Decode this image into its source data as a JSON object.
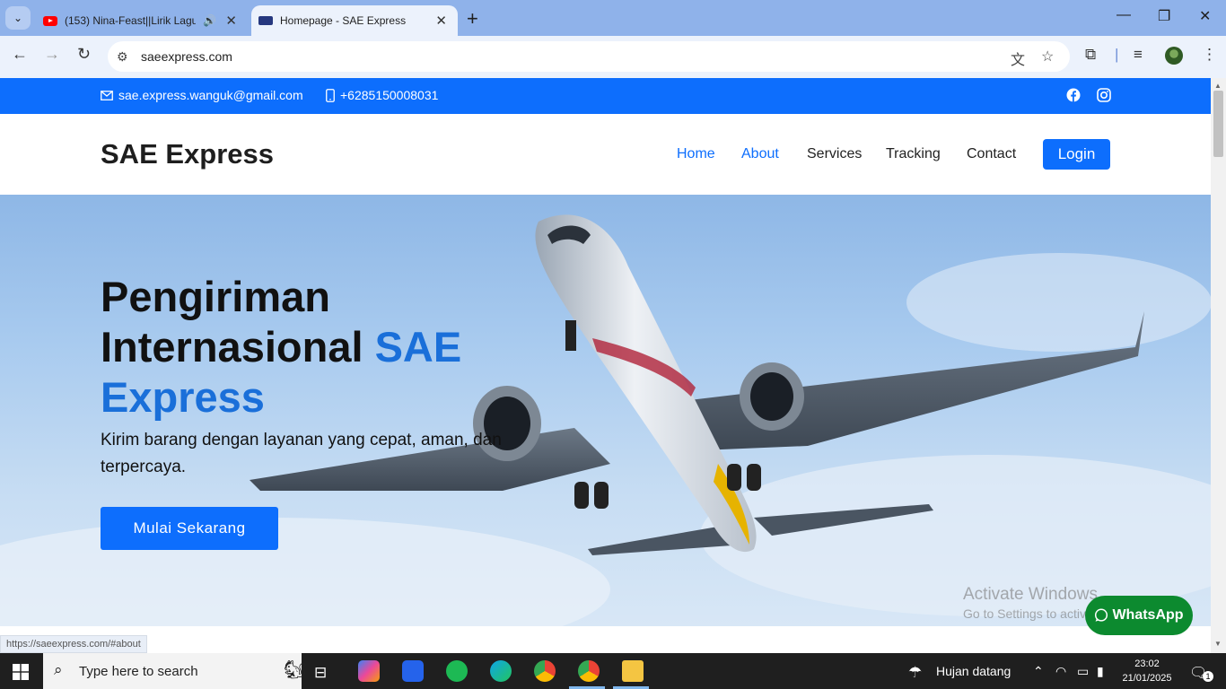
{
  "browser": {
    "tabs": [
      {
        "title": "(153) Nina-Feast||Lirik Lagu",
        "favicon": "youtube-icon",
        "audio": true
      },
      {
        "title": "Homepage - SAE Express",
        "favicon": "site-icon",
        "active": true
      }
    ],
    "url": "saeexpress.com",
    "status_link": "https://saeexpress.com/#about"
  },
  "topbar": {
    "email": "sae.express.wanguk@gmail.com",
    "phone": "+6285150008031"
  },
  "nav": {
    "brand": "SAE Express",
    "links": [
      "Home",
      "About",
      "Services",
      "Tracking",
      "Contact"
    ],
    "login": "Login"
  },
  "hero": {
    "title_line1": "Pengiriman",
    "title_line2": "Internasional",
    "title_accent1": "SAE",
    "title_accent2": "Express",
    "subtitle": "Kirim barang dengan layanan yang cepat, aman, dan terpercaya.",
    "cta": "Mulai Sekarang"
  },
  "watermark": {
    "line1": "Activate Windows",
    "line2": "Go to Settings to activate Windows."
  },
  "whatsapp": {
    "label": "WhatsApp"
  },
  "taskbar": {
    "search_placeholder": "Type here to search",
    "weather": "Hujan datang",
    "time": "23:02",
    "date": "21/01/2025",
    "notifications": "1"
  },
  "colors": {
    "brand_blue": "#0d6efd",
    "whatsapp_green": "#0c8a2f"
  }
}
